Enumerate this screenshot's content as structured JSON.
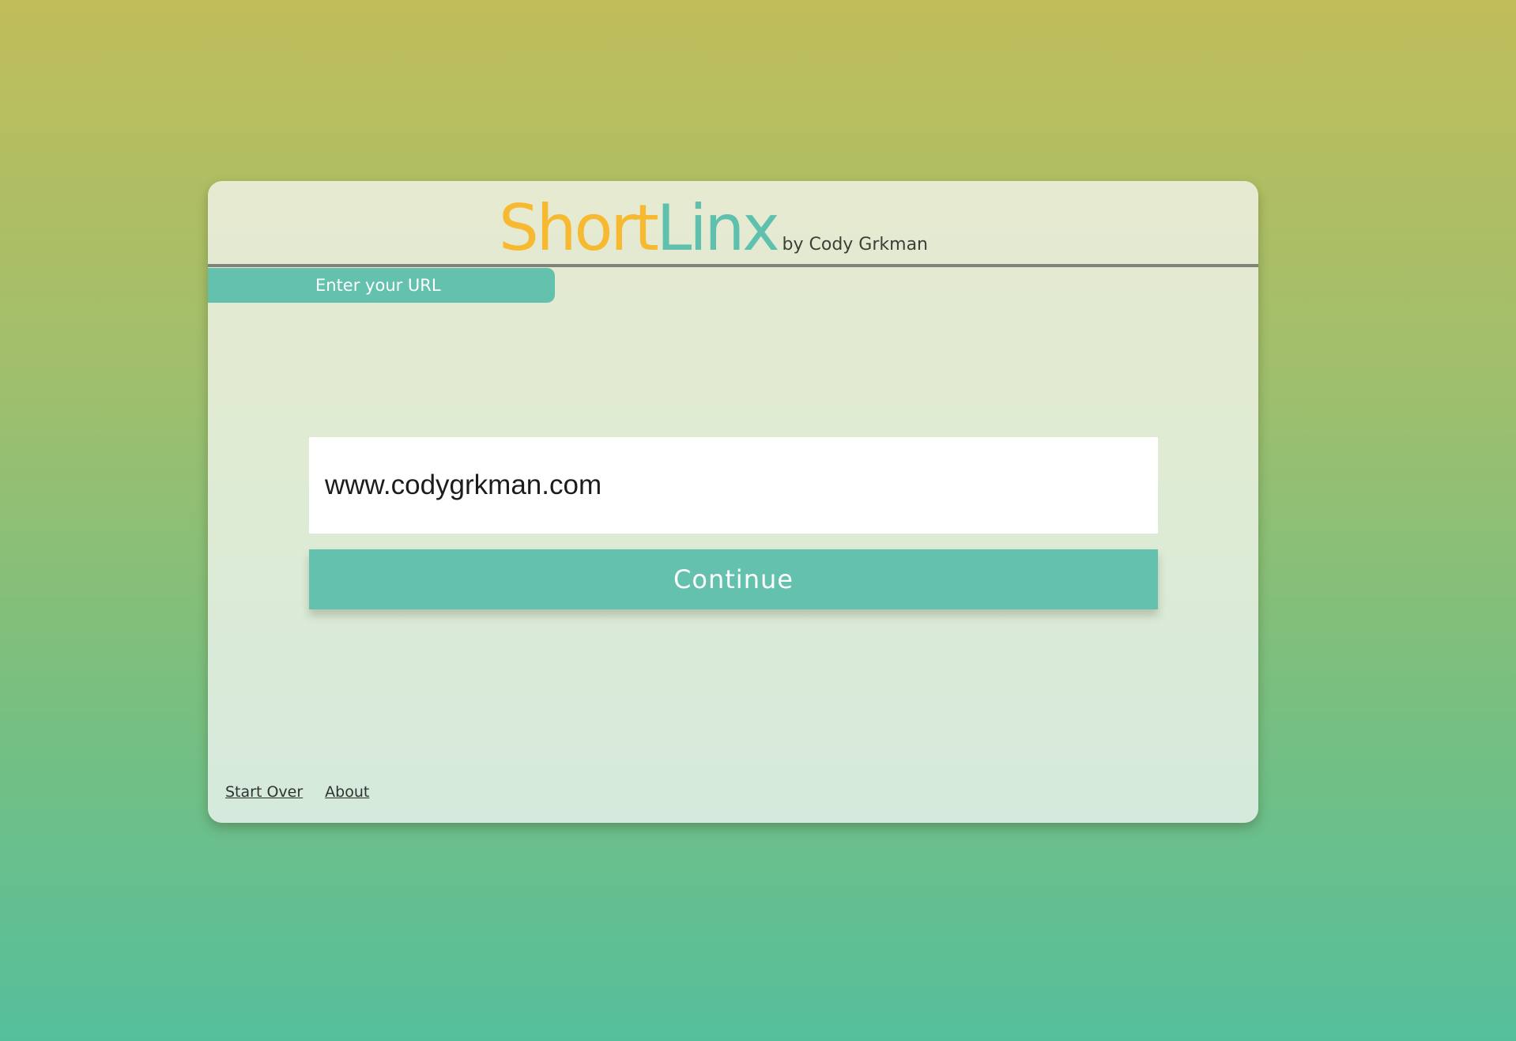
{
  "header": {
    "logo_short": "Short",
    "logo_linx": "Linx",
    "byline": "by Cody Grkman"
  },
  "step": {
    "label": "Enter your URL"
  },
  "form": {
    "url_value": "www.codygrkman.com",
    "continue_label": "Continue"
  },
  "footer": {
    "start_over_label": "Start Over",
    "about_label": "About"
  },
  "colors": {
    "logo_short": "#f6b92f",
    "logo_linx": "#5fc0ad",
    "accent": "#63c1ad"
  }
}
